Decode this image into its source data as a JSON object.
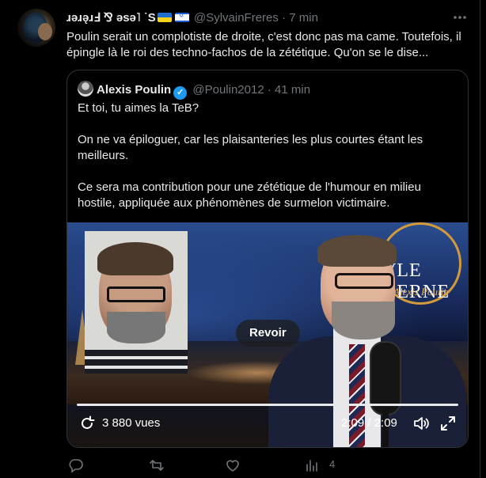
{
  "post": {
    "author_name": "ǝɹǝ̨ɹℲ ⅋ ǝsǝ˥ ˙S",
    "author_name_display": "ɹǝɹǝ̨ɹℲ ⅋ ǝsǝ˥ ˙S",
    "handle": "@SylvainFreres",
    "separator": "·",
    "time": "7 min",
    "more_icon": "more-horizontal-icon",
    "text": "Poulin serait un complotiste de droite, c'est donc pas ma came. Toutefois, il épingle là le roi des techno-fachos de la zététique. Qu'on se le dise..."
  },
  "quote": {
    "author_name": "Alexis Poulin",
    "handle": "@Poulin2012",
    "separator": "·",
    "time": "41 min",
    "paragraphs": [
      "Et toi, tu aimes la TeB?",
      "On ne va épiloguer, car les plaisanteries les plus courtes étant les meilleurs.",
      "Ce sera ma contribution pour une zététique de l'humour en milieu hostile, appliquée aux phénomènes de surmelon victimaire."
    ]
  },
  "video": {
    "replay_label": "Revoir",
    "views": "3 880 vues",
    "time": "2:09 / 2:09",
    "logo_text": "VLE DERNE",
    "logo_sub": "Alexis Poulin",
    "progress": 1.0
  },
  "actions": {
    "reply_icon": "reply-icon",
    "repost_icon": "repost-icon",
    "like_icon": "like-icon",
    "views_icon": "analytics-icon",
    "views_count": "4"
  }
}
